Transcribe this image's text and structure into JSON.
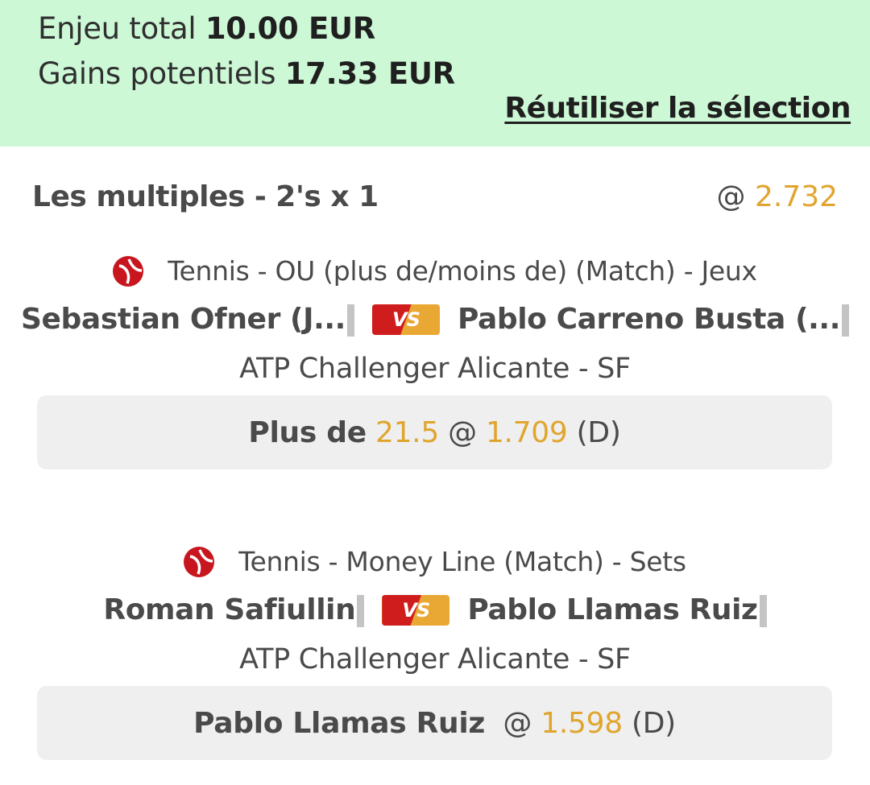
{
  "summary": {
    "stake_label": "Enjeu total",
    "stake_value": "10.00 EUR",
    "gains_label": "Gains potentiels",
    "gains_value": "17.33 EUR",
    "reuse_link": "Réutiliser la sélection"
  },
  "multiples": {
    "title": "Les multiples - 2's x 1",
    "at": "@",
    "odds": "2.732"
  },
  "vs_label": "VS",
  "events": [
    {
      "sport_icon": "tennis-ball-icon",
      "market": "Tennis - OU (plus de/moins de) (Match) - Jeux",
      "home": "Sebastian Ofner (J...",
      "away": "Pablo Carreno Busta (...",
      "tournament": "ATP Challenger Alicante - SF",
      "pick": {
        "selection": "Plus de",
        "line": "21.5",
        "at": "@",
        "odds": "1.709",
        "suffix": "(D)"
      }
    },
    {
      "sport_icon": "tennis-ball-icon",
      "market": "Tennis - Money Line (Match) - Sets",
      "home": "Roman Safiullin",
      "away": "Pablo Llamas Ruiz",
      "tournament": "ATP Challenger Alicante - SF",
      "pick": {
        "selection": "Pablo Llamas Ruiz",
        "at": "@",
        "odds": "1.598",
        "suffix": "(D)"
      }
    }
  ],
  "colors": {
    "summary_bg": "#cdf8d6",
    "odds_gold": "#e0a52e",
    "tennis_red": "#c8161e",
    "pick_bg": "#efefef"
  }
}
